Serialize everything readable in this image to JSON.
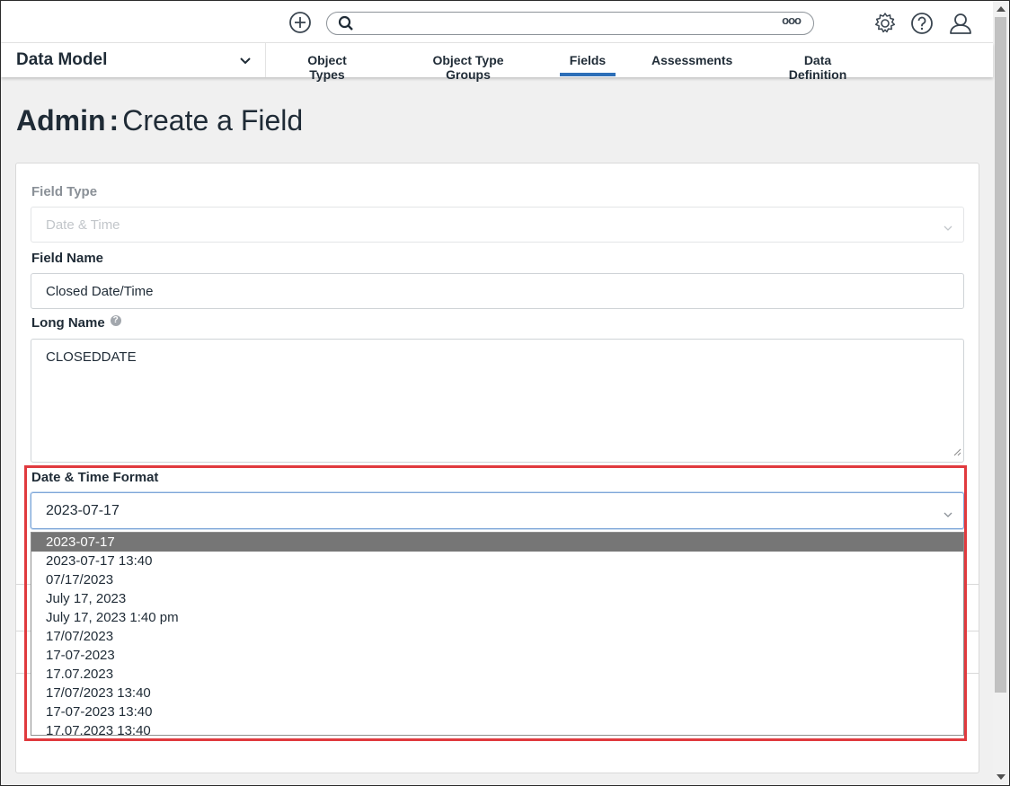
{
  "topbar": {
    "add_icon": "plus-circle-icon",
    "search_placeholder": "",
    "search_more": "ooo",
    "settings_icon": "gear-icon",
    "help_icon": "question-circle-icon",
    "user_icon": "user-icon"
  },
  "nav": {
    "selector_label": "Data Model",
    "tabs": [
      {
        "label": "Object Types",
        "active": false
      },
      {
        "label": "Object Type Groups",
        "active": false
      },
      {
        "label": "Fields",
        "active": true
      },
      {
        "label": "Assessments",
        "active": false
      },
      {
        "label": "Data Definition",
        "active": false
      }
    ],
    "accent": "#2d6fb8"
  },
  "page": {
    "title_prefix": "Admin",
    "title_sep": ":",
    "title_main": "Create a Field"
  },
  "form": {
    "field_type_label": "Field Type",
    "field_type_value": "Date & Time",
    "field_name_label": "Field Name",
    "field_name_value": "Closed Date/Time",
    "long_name_label": "Long Name",
    "long_name_help": "?",
    "long_name_value": "CLOSEDDATE",
    "dtf_label": "Date & Time Format",
    "dtf_value": "2023-07-17",
    "dtf_options": [
      "2023-07-17",
      "2023-07-17 13:40",
      "07/17/2023",
      "July 17, 2023",
      "July 17, 2023 1:40 pm",
      "17/07/2023",
      "17-07-2023",
      "17.07.2023",
      "17/07/2023 13:40",
      "17-07-2023 13:40",
      "17.07.2023 13:40"
    ]
  },
  "colors": {
    "highlight": "#e03a3e",
    "selected_option_bg": "#767676"
  }
}
